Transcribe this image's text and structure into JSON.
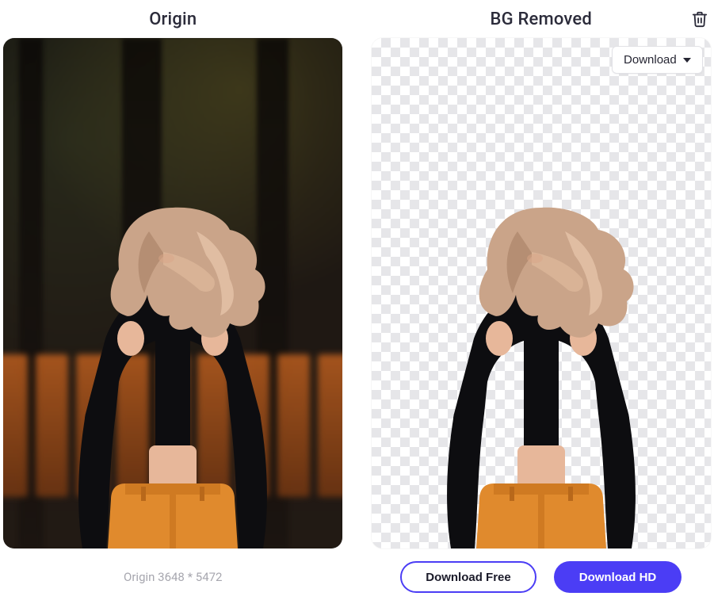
{
  "panels": {
    "origin": {
      "title": "Origin",
      "dimensions_label": "Origin 3648 * 5472"
    },
    "removed": {
      "title": "BG Removed",
      "download_dropdown_label": "Download"
    }
  },
  "actions": {
    "download_free": "Download Free",
    "download_hd": "Download HD"
  },
  "icons": {
    "trash": "trash-icon",
    "caret": "chevron-down-icon"
  }
}
